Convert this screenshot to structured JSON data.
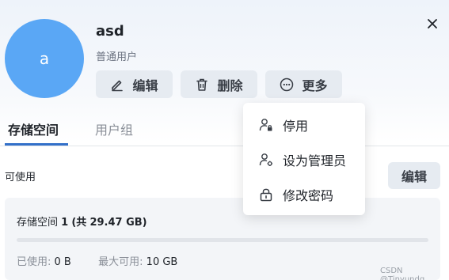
{
  "user": {
    "avatar_letter": "a",
    "name": "asd",
    "role": "普通用户"
  },
  "actions": {
    "edit_label": "编辑",
    "delete_label": "删除",
    "more_label": "更多"
  },
  "tabs": [
    {
      "label": "存储空间",
      "active": true
    },
    {
      "label": "用户组",
      "active": false
    }
  ],
  "status": {
    "available_label": "可使用",
    "edit_label": "编辑"
  },
  "storage": {
    "title_prefix": "存储空间",
    "title_count": "1",
    "title_total_prefix": "(共",
    "title_total": "29.47 GB",
    "title_suffix": ")",
    "used_label": "已使用:",
    "used_value": "0 B",
    "max_label": "最大可用:",
    "max_value": "10 GB",
    "usage_fraction": 0
  },
  "more_menu": {
    "items": [
      {
        "label": "停用",
        "icon": "user-lock-icon"
      },
      {
        "label": "设为管理员",
        "icon": "user-gear-icon"
      },
      {
        "label": "修改密码",
        "icon": "lock-icon"
      }
    ]
  },
  "watermark": "CSDN @Tinyundg",
  "colors": {
    "avatar": "#5aa7f5",
    "accent": "#3370c9",
    "button_bg": "#e6ebf1"
  }
}
